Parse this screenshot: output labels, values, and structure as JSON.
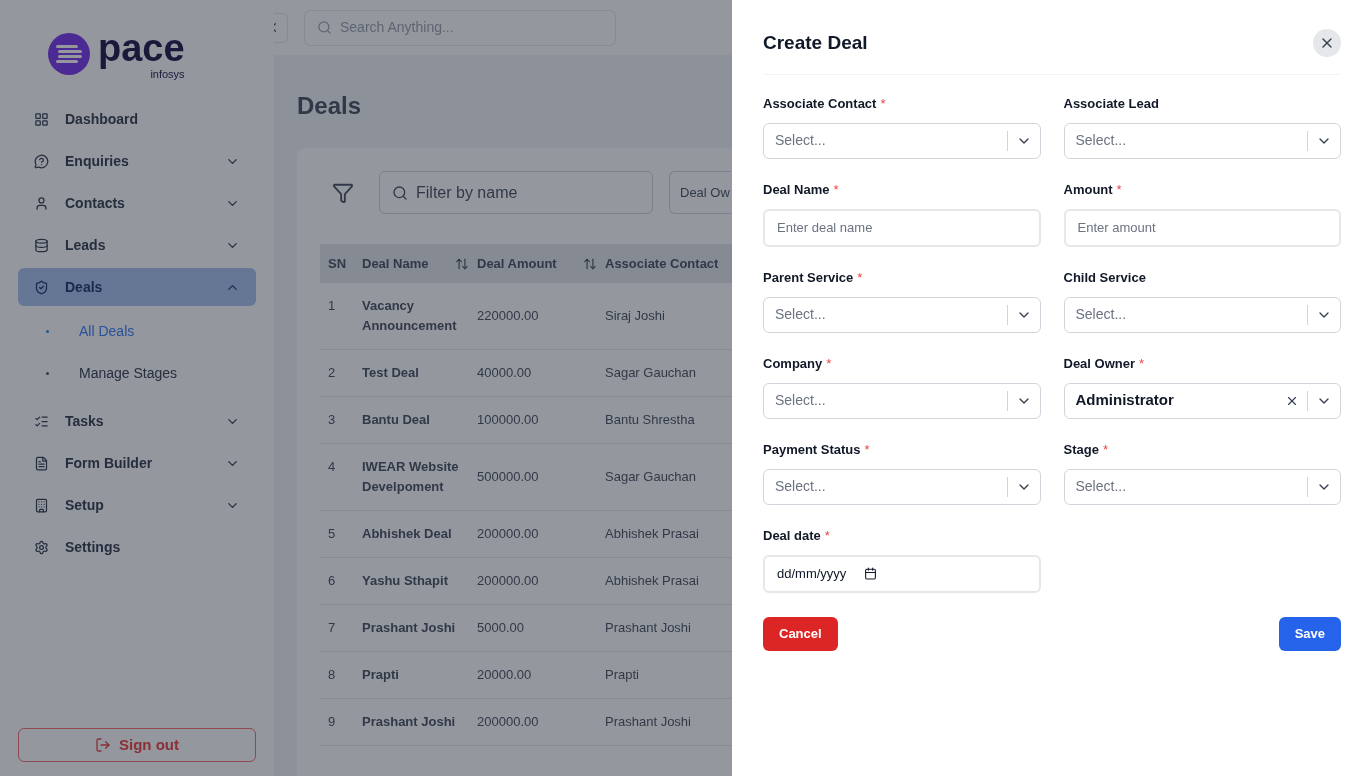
{
  "logo": {
    "name": "pace",
    "tagline": "infosys"
  },
  "topbar": {
    "search_placeholder": "Search Anything..."
  },
  "sidebar": {
    "items": [
      {
        "label": "Dashboard",
        "kind": "link",
        "selected": false
      },
      {
        "label": "Enquiries",
        "kind": "group",
        "expanded": false,
        "selected": false
      },
      {
        "label": "Contacts",
        "kind": "group",
        "expanded": false,
        "selected": false
      },
      {
        "label": "Leads",
        "kind": "group",
        "expanded": false,
        "selected": false
      },
      {
        "label": "Deals",
        "kind": "group",
        "expanded": true,
        "selected": true,
        "children": [
          {
            "label": "All Deals",
            "selected": true
          },
          {
            "label": "Manage Stages",
            "selected": false
          }
        ]
      },
      {
        "label": "Tasks",
        "kind": "group",
        "expanded": false,
        "selected": false
      },
      {
        "label": "Form Builder",
        "kind": "group",
        "expanded": false,
        "selected": false
      },
      {
        "label": "Setup",
        "kind": "group",
        "expanded": false,
        "selected": false
      },
      {
        "label": "Settings",
        "kind": "link",
        "selected": false
      }
    ],
    "sign_out": "Sign out"
  },
  "page": {
    "title": "Deals",
    "filter_placeholder": "Filter by name",
    "owner_filter": "Deal Ow"
  },
  "table": {
    "columns": [
      {
        "label": "SN",
        "kind": "plain"
      },
      {
        "label": "Deal Name",
        "kind": "sortable"
      },
      {
        "label": "Deal Amount",
        "kind": "sortable"
      },
      {
        "label": "Associate Contact",
        "kind": "plain"
      }
    ],
    "rows": [
      [
        "1",
        "Vacancy Announcement",
        "220000.00",
        "Siraj Joshi"
      ],
      [
        "2",
        "Test Deal",
        "40000.00",
        "Sagar Gauchan"
      ],
      [
        "3",
        "Bantu Deal",
        "100000.00",
        "Bantu Shrestha"
      ],
      [
        "4",
        "IWEAR Website Develpoment",
        "500000.00",
        "Sagar Gauchan"
      ],
      [
        "5",
        "Abhishek Deal",
        "200000.00",
        "Abhishek Prasai"
      ],
      [
        "6",
        "Yashu Sthapit",
        "200000.00",
        "Abhishek Prasai"
      ],
      [
        "7",
        "Prashant Joshi",
        "5000.00",
        "Prashant Joshi"
      ],
      [
        "8",
        "Prapti",
        "20000.00",
        "Prapti"
      ],
      [
        "9",
        "Prashant Joshi",
        "200000.00",
        "Prashant Joshi"
      ]
    ]
  },
  "drawer": {
    "title": "Create Deal",
    "fields": [
      {
        "label": "Associate Contact",
        "required": true,
        "kind": "select",
        "placeholder": "Select..."
      },
      {
        "label": "Associate Lead",
        "required": false,
        "kind": "select",
        "placeholder": "Select..."
      },
      {
        "label": "Deal Name",
        "required": true,
        "kind": "text",
        "placeholder": "Enter deal name"
      },
      {
        "label": "Amount",
        "required": true,
        "kind": "text",
        "placeholder": "Enter amount"
      },
      {
        "label": "Parent Service",
        "required": true,
        "kind": "select",
        "placeholder": "Select..."
      },
      {
        "label": "Child Service",
        "required": false,
        "kind": "select",
        "placeholder": "Select..."
      },
      {
        "label": "Company",
        "required": true,
        "kind": "select",
        "placeholder": "Select..."
      },
      {
        "label": "Deal Owner",
        "required": true,
        "kind": "select",
        "value": "Administrator"
      },
      {
        "label": "Payment Status",
        "required": true,
        "kind": "select",
        "placeholder": "Select..."
      },
      {
        "label": "Stage",
        "required": true,
        "kind": "select",
        "placeholder": "Select..."
      },
      {
        "label": "Deal date",
        "required": true,
        "kind": "date",
        "value": "dd/mm/yyyy"
      }
    ],
    "required_mark": "*",
    "cancel": "Cancel",
    "save": "Save"
  }
}
